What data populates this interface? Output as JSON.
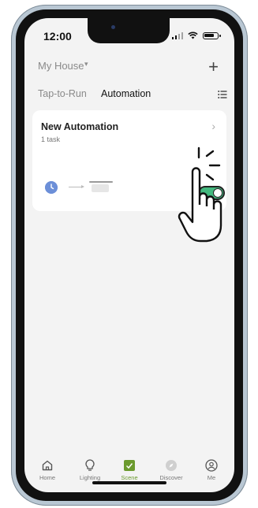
{
  "status_bar": {
    "time": "12:00"
  },
  "header": {
    "house_name": "My House",
    "caret": "▾",
    "add_icon": "+"
  },
  "tabs": {
    "tap_to_run": "Tap-to-Run",
    "automation": "Automation"
  },
  "automation_card": {
    "title": "New Automation",
    "subtitle": "1 task",
    "enabled": true
  },
  "bottom_nav": [
    {
      "label": "Home",
      "icon": "home-icon",
      "active": false
    },
    {
      "label": "Lighting",
      "icon": "bulb-icon",
      "active": false
    },
    {
      "label": "Scene",
      "icon": "scene-check-icon",
      "active": true
    },
    {
      "label": "Discover",
      "icon": "discover-icon",
      "active": false
    },
    {
      "label": "Me",
      "icon": "user-icon",
      "active": false
    }
  ],
  "colors": {
    "accent_green": "#43b97f",
    "scene_active": "#6b9a2e",
    "clock_blue": "#6c8fd8"
  }
}
